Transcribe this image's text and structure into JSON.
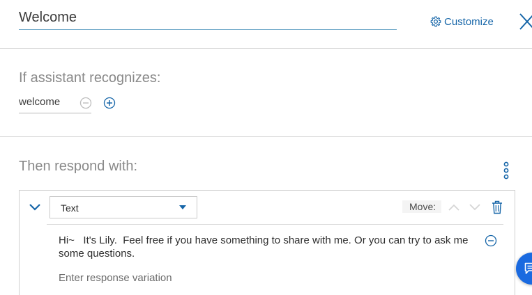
{
  "header": {
    "title": "Welcome",
    "customize_label": "Customize",
    "close_icon": "close-icon",
    "customize_icon": "gear-icon"
  },
  "condition": {
    "heading": "If assistant recognizes:",
    "value": "welcome"
  },
  "response": {
    "heading": "Then respond with:",
    "type_selected": "Text",
    "move_label": "Move:",
    "text": "Hi~   It's Lily.  Feel free if you have something to share with me. Or you can try to ask me some questions.",
    "variation_placeholder": "Enter response variation"
  },
  "colors": {
    "accent": "#1565a8",
    "fab": "#1a6ae0",
    "muted_heading": "#8a8a8a",
    "divider": "#d6d6d6"
  }
}
